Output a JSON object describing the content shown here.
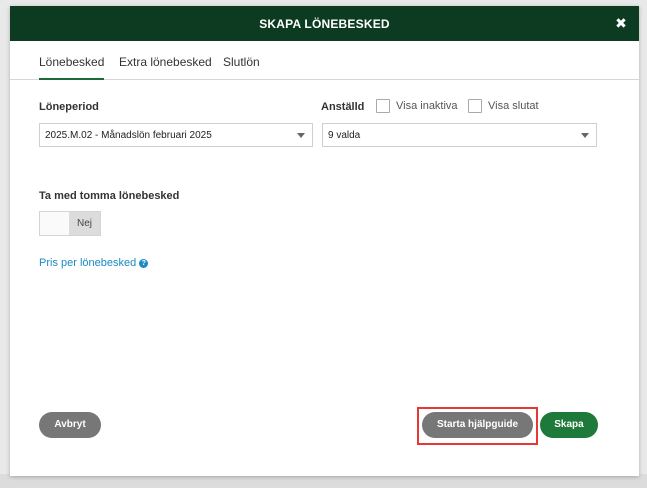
{
  "dialog": {
    "title": "SKAPA LÖNEBESKED",
    "close_icon": "close-icon"
  },
  "tabs": [
    {
      "label": "Lönebesked",
      "active": true
    },
    {
      "label": "Extra lönebesked",
      "active": false
    },
    {
      "label": "Slutlön",
      "active": false
    }
  ],
  "form": {
    "loneperiod_label": "Löneperiod",
    "loneperiod_value": "2025.M.02 - Månadslön februari 2025",
    "anstalld_label": "Anställd",
    "visa_inaktiva_label": "Visa inaktiva",
    "visa_slutat_label": "Visa slutat",
    "anstalld_value": "9 valda",
    "tomma_label": "Ta med tomma lönebesked",
    "toggle_value": "Nej",
    "pris_link": "Pris per lönebesked",
    "help_icon": "?"
  },
  "buttons": {
    "cancel": "Avbryt",
    "guide": "Starta hjälpguide",
    "create": "Skapa"
  },
  "colors": {
    "header_bg": "#0d3b22",
    "primary_green": "#1e7a3a",
    "link_blue": "#1a8bc4",
    "highlight_red": "#e53935"
  }
}
